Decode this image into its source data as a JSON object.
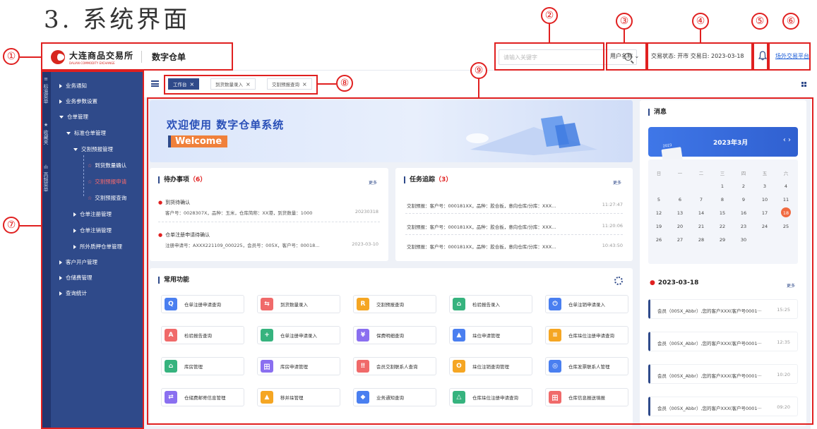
{
  "doc_title": "3. 系统界面",
  "annotations": [
    "①",
    "②",
    "③",
    "④",
    "⑤",
    "⑥",
    "⑦",
    "⑧",
    "⑨"
  ],
  "header": {
    "logo_cn": "大连商品交易所",
    "logo_en": "DALIAN COMMODITY EXCHANGE",
    "system_name": "数字仓单",
    "search_placeholder": "请输入关键字",
    "user_name": "用户名称",
    "status_text": "交易状态: 开市    交易日: 2023-03-18",
    "ext_link": "场外交易平台"
  },
  "vertical_tabs": [
    {
      "icon": "≡",
      "label": "标准菜单"
    },
    {
      "icon": "★",
      "label": "收藏夹"
    },
    {
      "icon": "ılı",
      "label": "高频菜单"
    }
  ],
  "sidebar": {
    "items": [
      {
        "label": "业务通知"
      },
      {
        "label": "业务参数设置"
      },
      {
        "label": "仓单管理"
      },
      {
        "label": "标准仓单管理"
      },
      {
        "label": "交割预报管理"
      },
      {
        "label": "到货数量确认"
      },
      {
        "label": "交割预报申请"
      },
      {
        "label": "交割预报查询"
      },
      {
        "label": "仓单注册管理"
      },
      {
        "label": "仓单注销管理"
      },
      {
        "label": "所外质押仓单管理"
      },
      {
        "label": "客户开户管理"
      },
      {
        "label": "仓储费管理"
      },
      {
        "label": "查询统计"
      }
    ]
  },
  "tabs": [
    {
      "label": "工作台"
    },
    {
      "label": "到货数量录入"
    },
    {
      "label": "交割预报查询"
    }
  ],
  "banner": {
    "title": "欢迎使用  数字仓单系统",
    "welcome": "Welcome"
  },
  "todo": {
    "title": "待办事项",
    "count": "（6）",
    "more": "更多",
    "items": [
      {
        "title": "到货待确认",
        "detail": "客户号：0028307X，品种：玉米，仓库简称：XX港，到货数量：1000",
        "date": "20230318"
      },
      {
        "title": "仓单注册申请待确认",
        "detail": "注册申请号：AXXX221109_000225，会员号：005X，客户号：00018...",
        "date": "2023-03-10"
      }
    ]
  },
  "tasks": {
    "title": "任务追踪",
    "count": "（3）",
    "more": "更多",
    "items": [
      {
        "text": "交割预报：客户号：000181XX，品种：胶合板，意向仓库/分库：XXX...",
        "time": "11:27:47"
      },
      {
        "text": "交割预报：客户号：000181XX，品种：胶合板，意向仓库/分库：XXX...",
        "time": "11:20:06"
      },
      {
        "text": "交割预报：客户号：000181XX，品种：胶合板，意向仓库/分库：XXX...",
        "time": "10:43:50"
      }
    ]
  },
  "functions": {
    "title": "常用功能",
    "items": [
      {
        "label": "仓单注册申请查询",
        "icon": "Q",
        "color": "#4a7ff0"
      },
      {
        "label": "到货数量录入",
        "icon": "⇆",
        "color": "#f06a6a"
      },
      {
        "label": "交割预报查询",
        "icon": "R",
        "color": "#f5a623"
      },
      {
        "label": "检验报告录入",
        "icon": "⌂",
        "color": "#36b37e"
      },
      {
        "label": "仓单注销申请录入",
        "icon": "⏻",
        "color": "#4a7ff0"
      },
      {
        "label": "检验报告查询",
        "icon": "A",
        "color": "#f06a6a"
      },
      {
        "label": "仓单注册申请录入",
        "icon": "+",
        "color": "#36b37e"
      },
      {
        "label": "保费明细查询",
        "icon": "¥",
        "color": "#8a6ff0"
      },
      {
        "label": "垛位申请管理",
        "icon": "▲",
        "color": "#4a7ff0"
      },
      {
        "label": "仓库垛位注册申请查询",
        "icon": "≡",
        "color": "#f5a623"
      },
      {
        "label": "库房管理",
        "icon": "⌂",
        "color": "#36b37e"
      },
      {
        "label": "库房申请管理",
        "icon": "田",
        "color": "#8a6ff0"
      },
      {
        "label": "会员交割联系人查询",
        "icon": "‼",
        "color": "#f06a6a"
      },
      {
        "label": "垛位注销查询管理",
        "icon": "O",
        "color": "#f5a623"
      },
      {
        "label": "仓库发票联系人管理",
        "icon": "◎",
        "color": "#4a7ff0"
      },
      {
        "label": "仓储费邮寄信息管理",
        "icon": "⇄",
        "color": "#8a6ff0"
      },
      {
        "label": "移并垛管理",
        "icon": "▲",
        "color": "#f5a623"
      },
      {
        "label": "业务通知查询",
        "icon": "◆",
        "color": "#4a7ff0"
      },
      {
        "label": "仓库垛位注册申请查询",
        "icon": "△",
        "color": "#36b37e"
      },
      {
        "label": "仓库信息报送填报",
        "icon": "田",
        "color": "#f06a6a"
      }
    ]
  },
  "calendar": {
    "title": "消息",
    "month": "2023年3月",
    "pad_text": "2023",
    "arrows": "‹  ›",
    "weekdays": [
      "日",
      "一",
      "二",
      "三",
      "四",
      "五",
      "六"
    ],
    "days": [
      "",
      "",
      "",
      "1",
      "2",
      "3",
      "4",
      "5",
      "6",
      "7",
      "8",
      "9",
      "10",
      "11",
      "12",
      "13",
      "14",
      "15",
      "16",
      "17",
      "18",
      "19",
      "20",
      "21",
      "22",
      "23",
      "24",
      "25",
      "26",
      "27",
      "28",
      "29",
      "30"
    ],
    "today": "18"
  },
  "messages": {
    "date": "2023-03-18",
    "more": "更多",
    "items": [
      {
        "text": "会员（005X_Abbr）,您的客户XXX(客户号0001···",
        "time": "15:25"
      },
      {
        "text": "会员（005X_Abbr）,您的客户XXX(客户号0001···",
        "time": "12:35"
      },
      {
        "text": "会员（005X_Abbr）,您的客户XXX(客户号0001···",
        "time": "10:20"
      },
      {
        "text": "会员（005X_Abbr）,您的客户XXX(客户号0001···",
        "time": "09:20"
      }
    ]
  },
  "colors": {
    "primary": "#2f4a8a",
    "accent_red": "#e02020",
    "sidebar_dark": "#22366f"
  }
}
